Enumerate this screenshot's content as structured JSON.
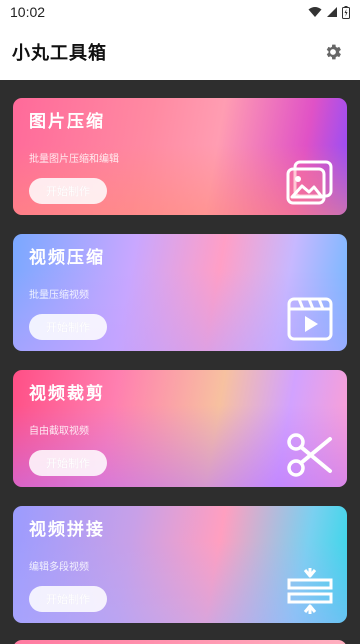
{
  "status_bar": {
    "time": "10:02",
    "icons": [
      "wifi-icon",
      "signal-icon",
      "battery-icon"
    ]
  },
  "app_bar": {
    "title": "小丸工具箱",
    "settings_icon": "gear-icon"
  },
  "cards": [
    {
      "title": "图片压缩",
      "desc": "批量图片压缩和编辑",
      "button": "开始制作",
      "icon": "image-icon"
    },
    {
      "title": "视频压缩",
      "desc": "批量压缩视频",
      "button": "开始制作",
      "icon": "video-player-icon"
    },
    {
      "title": "视频裁剪",
      "desc": "自由截取视频",
      "button": "开始制作",
      "icon": "scissors-icon"
    },
    {
      "title": "视频拼接",
      "desc": "编辑多段视频",
      "button": "开始制作",
      "icon": "merge-icon"
    }
  ],
  "colors": {
    "content_bg": "#2e2e2e",
    "card_text": "#ffffff"
  }
}
